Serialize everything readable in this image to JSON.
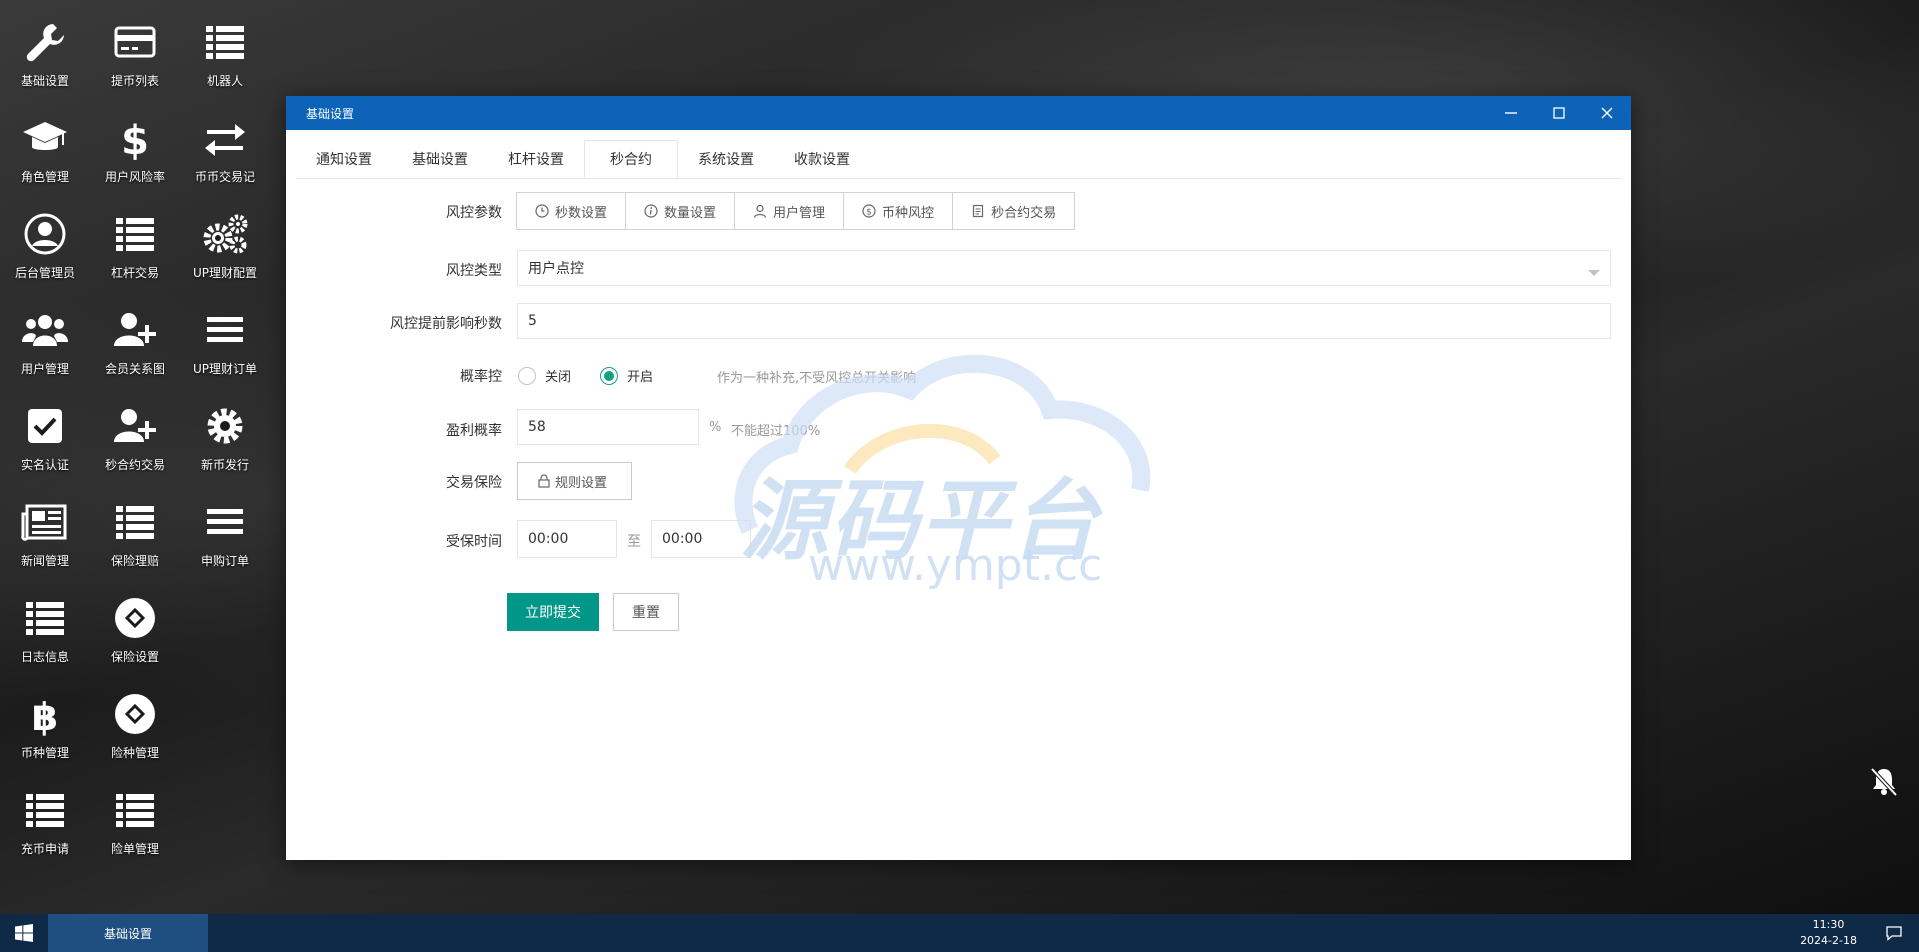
{
  "desktop_icons": [
    {
      "label": "基础设置",
      "icon": "wrench-icon"
    },
    {
      "label": "提币列表",
      "icon": "credit-card-icon"
    },
    {
      "label": "机器人",
      "icon": "list-icon"
    },
    {
      "label": "角色管理",
      "icon": "graduation-cap-icon"
    },
    {
      "label": "用户风险率",
      "icon": "dollar-icon"
    },
    {
      "label": "币币交易记",
      "icon": "exchange-icon"
    },
    {
      "label": "后台管理员",
      "icon": "user-circle-icon"
    },
    {
      "label": "杠杆交易",
      "icon": "list-icon"
    },
    {
      "label": "UP理财配置",
      "icon": "gears-icon"
    },
    {
      "label": "用户管理",
      "icon": "users-icon"
    },
    {
      "label": "会员关系图",
      "icon": "user-plus-icon"
    },
    {
      "label": "UP理财订单",
      "icon": "bars-icon"
    },
    {
      "label": "实名认证",
      "icon": "check-square-icon"
    },
    {
      "label": "秒合约交易",
      "icon": "user-plus-icon"
    },
    {
      "label": "新币发行",
      "icon": "gear-icon"
    },
    {
      "label": "新闻管理",
      "icon": "newspaper-icon"
    },
    {
      "label": "保险理赔",
      "icon": "list-icon"
    },
    {
      "label": "申购订单",
      "icon": "bars-icon"
    },
    {
      "label": "日志信息",
      "icon": "list-icon"
    },
    {
      "label": "保险设置",
      "icon": "link-circle-icon"
    },
    {
      "label": "币种管理",
      "icon": "bitcoin-icon"
    },
    {
      "label": "险种管理",
      "icon": "link-circle-icon"
    },
    {
      "label": "充币申请",
      "icon": "list-icon"
    },
    {
      "label": "险单管理",
      "icon": "list-icon"
    }
  ],
  "window": {
    "title": "基础设置",
    "tabs": [
      "通知设置",
      "基础设置",
      "杠杆设置",
      "秒合约",
      "系统设置",
      "收款设置"
    ],
    "active_tab": "秒合约"
  },
  "form": {
    "risk_params_label": "风控参数",
    "risk_buttons": [
      {
        "label": "秒数设置",
        "icon": "clock-icon"
      },
      {
        "label": "数量设置",
        "icon": "info-icon"
      },
      {
        "label": "用户管理",
        "icon": "user-icon"
      },
      {
        "label": "币种风控",
        "icon": "dollar-circle-icon"
      },
      {
        "label": "秒合约交易",
        "icon": "document-icon"
      }
    ],
    "risk_type_label": "风控类型",
    "risk_type_value": "用户点控",
    "advance_seconds_label": "风控提前影响秒数",
    "advance_seconds_value": "5",
    "prob_control_label": "概率控",
    "prob_off_label": "关闭",
    "prob_on_label": "开启",
    "prob_tip": "作为一种补充,不受风控总开关影响",
    "profit_rate_label": "盈利概率",
    "profit_rate_value": "58",
    "profit_rate_unit": "%",
    "profit_rate_tip": "不能超过100%",
    "insurance_label": "交易保险",
    "rule_button_label": "规则设置",
    "protect_time_label": "受保时间",
    "protect_start": "00:00",
    "protect_to": "至",
    "protect_end": "00:00",
    "submit_label": "立即提交",
    "reset_label": "重置"
  },
  "watermark": {
    "title": "源码平台",
    "url": "www.ympt.cc"
  },
  "taskbar": {
    "active_window": "基础设置",
    "time": "11:30",
    "date": "2024-2-18"
  },
  "colors": {
    "titlebar": "#0c63b8",
    "primary": "#009688",
    "taskbar": "#0e2a47"
  }
}
